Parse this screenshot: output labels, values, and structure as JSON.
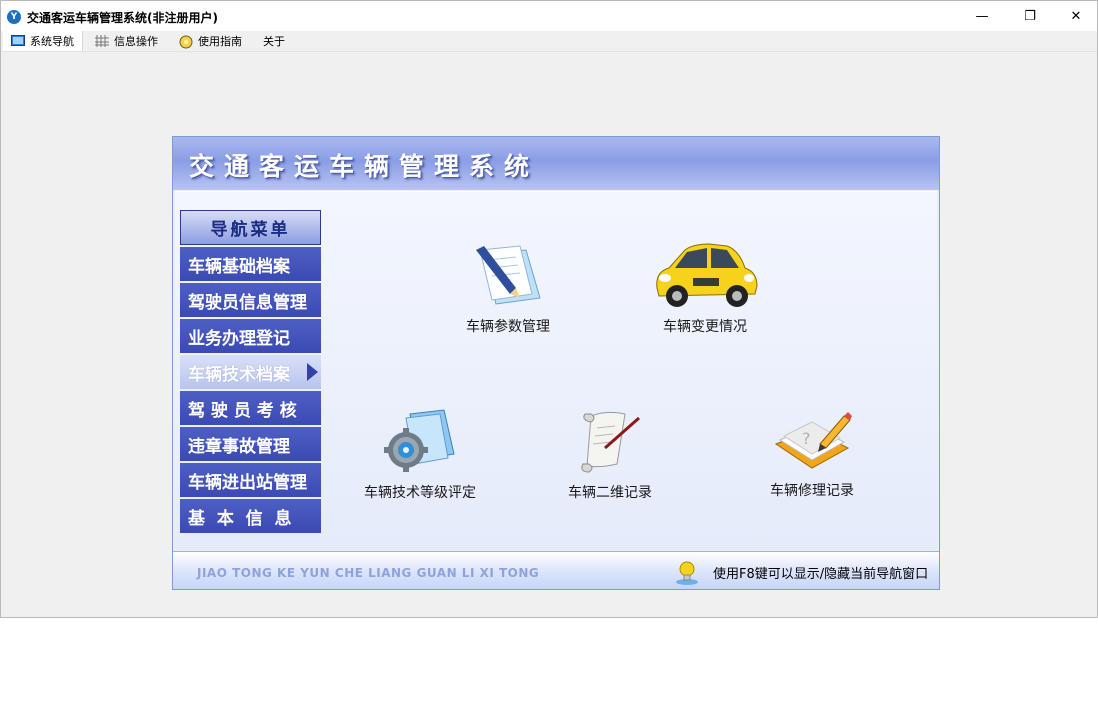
{
  "window": {
    "title": "交通客运车辆管理系统(非注册用户)",
    "minimize": "—",
    "restore": "❐",
    "close": "✕"
  },
  "menu": [
    {
      "label": "系统导航",
      "icon": "monitor-icon"
    },
    {
      "label": "信息操作",
      "icon": "grid-icon"
    },
    {
      "label": "使用指南",
      "icon": "guide-icon"
    },
    {
      "label": "关于",
      "icon": ""
    }
  ],
  "banner": {
    "title": "交通客运车辆管理系统"
  },
  "nav": {
    "header": "导航菜单",
    "items": [
      {
        "label": "车辆基础档案"
      },
      {
        "label": "驾驶员信息管理"
      },
      {
        "label": "业务办理登记"
      },
      {
        "label": "车辆技术档案",
        "selected": true
      },
      {
        "label": "驾 驶 员 考 核"
      },
      {
        "label": "违章事故管理"
      },
      {
        "label": "车辆进出站管理"
      },
      {
        "label": "基  本  信  息"
      }
    ]
  },
  "features": [
    {
      "label": "车辆参数管理",
      "icon": "document-pen-icon"
    },
    {
      "label": "车辆变更情况",
      "icon": "car-icon"
    },
    {
      "label": "车辆技术等级评定",
      "icon": "gear-folder-icon"
    },
    {
      "label": "车辆二维记录",
      "icon": "scroll-icon"
    },
    {
      "label": "车辆修理记录",
      "icon": "notebook-pencil-icon"
    }
  ],
  "footer": {
    "brand": "JIAO TONG KE YUN CHE LIANG GUAN LI XI TONG",
    "tip": "使用F8键可以显示/隐藏当前导航窗口"
  },
  "colors": {
    "nav_item": "#4455bb",
    "banner": "#8a9ee6",
    "content_bg": "#e9eefb"
  }
}
